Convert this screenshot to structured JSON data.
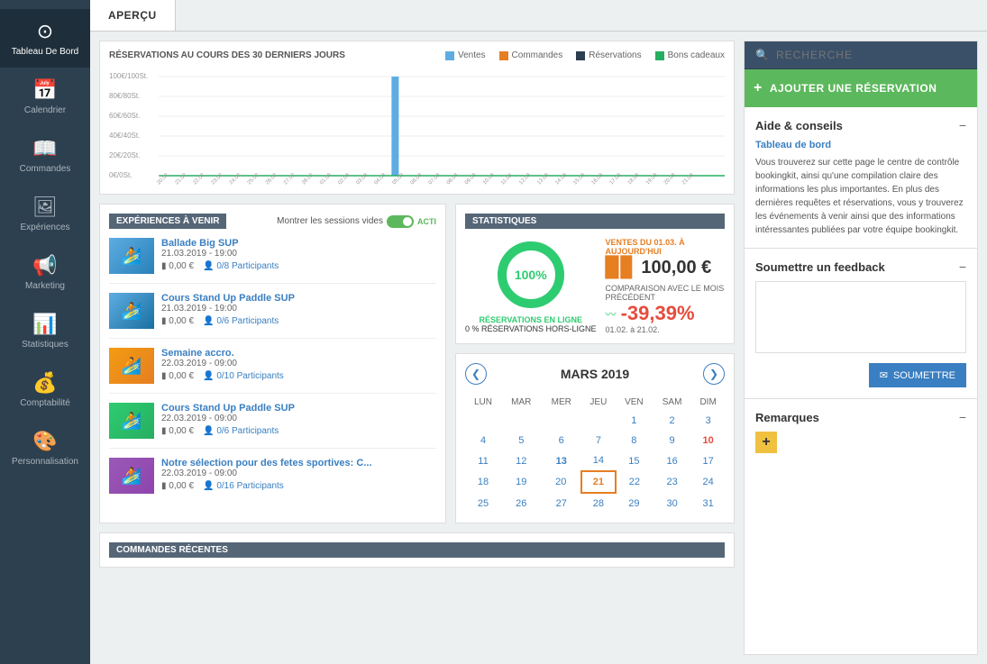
{
  "sidebar": {
    "items": [
      {
        "id": "tableau",
        "label": "Tableau De Bord",
        "icon": "⊙",
        "active": true
      },
      {
        "id": "calendrier",
        "label": "Calendrier",
        "icon": "📅"
      },
      {
        "id": "commandes",
        "label": "Commandes",
        "icon": "📖"
      },
      {
        "id": "experiences",
        "label": "Expériences",
        "icon": "🖼"
      },
      {
        "id": "marketing",
        "label": "Marketing",
        "icon": "📢"
      },
      {
        "id": "statistiques",
        "label": "Statistiques",
        "icon": "📊"
      },
      {
        "id": "comptabilite",
        "label": "Comptabilité",
        "icon": "💰"
      },
      {
        "id": "personnalisation",
        "label": "Personnalisation",
        "icon": "🎨"
      }
    ]
  },
  "tab": {
    "label": "APERÇU"
  },
  "search": {
    "placeholder": "RECHERCHE"
  },
  "add_button": {
    "label": "AJOUTER UNE RÉSERVATION",
    "plus": "+"
  },
  "chart": {
    "title": "RÉSERVATIONS AU COURS DES 30 DERNIERS JOURS",
    "legend": [
      {
        "label": "Ventes",
        "color": "#5dade2"
      },
      {
        "label": "Commandes",
        "color": "#e67e22"
      },
      {
        "label": "Réservations",
        "color": "#2c3e50"
      },
      {
        "label": "Bons cadeaux",
        "color": "#27ae60"
      }
    ],
    "y_labels": [
      "100€ / 100 St.",
      "80€ / 80 St.",
      "60€ / 60 St.",
      "40€ / 40 St.",
      "20€ / 20 St.",
      "0€ / 0 St."
    ],
    "x_dates": [
      "20.02",
      "21.02",
      "22.02",
      "23.02",
      "24.02",
      "25.02",
      "26.02",
      "27.02",
      "28.02",
      "01.03",
      "02.03",
      "03.03",
      "04.03",
      "05.03",
      "06.03",
      "07.03",
      "08.03",
      "09.03",
      "10.03",
      "11.03",
      "12.03",
      "13.03",
      "14.03",
      "15.03",
      "16.03",
      "17.03",
      "18.03",
      "19.03",
      "20.03",
      "21.03"
    ],
    "spike_index": 14,
    "spike_height": 100
  },
  "experiences": {
    "section_title": "EXPÉRIENCES À VENIR",
    "toggle_label": "Montrer les sessions vides",
    "toggle_state": "ACTI",
    "items": [
      {
        "title": "Ballade Big SUP",
        "date": "21.03.2019 - 19:00",
        "price": "0,00 €",
        "participants": "0/8 Participants",
        "img_class": "exp-img-1"
      },
      {
        "title": "Cours Stand Up Paddle SUP",
        "date": "21.03.2019 - 19:00",
        "price": "0,00 €",
        "participants": "0/6 Participants",
        "img_class": "exp-img-2"
      },
      {
        "title": "Semaine accro.",
        "date": "22.03.2019 - 09:00",
        "price": "0,00 €",
        "participants": "0/10 Participants",
        "img_class": "exp-img-3"
      },
      {
        "title": "Cours Stand Up Paddle SUP",
        "date": "22.03.2019 - 09:00",
        "price": "0,00 €",
        "participants": "0/6 Participants",
        "img_class": "exp-img-4"
      },
      {
        "title": "Notre sélection pour des fetes sportives: C...",
        "date": "22.03.2019 - 09:00",
        "price": "0,00 €",
        "participants": "0/16 Participants",
        "img_class": "exp-img-5"
      }
    ]
  },
  "statistics": {
    "section_title": "STATISTIQUES",
    "donut_percent": "100%",
    "sales_label": "VENTES DU 01.03. À AUJOURD'HUI",
    "sales_amount": "100,00 €",
    "comparison_label": "COMPARAISON AVEC LE MOIS PRÉCÉDENT",
    "comparison_range": "01.02. à 21.02.",
    "percent_change": "-39,39%",
    "reservations_label": "RÉSERVATIONS EN LIGNE",
    "reservations_sub": "0 % RÉSERVATIONS HORS-LIGNE"
  },
  "calendar": {
    "month_label": "MARS 2019",
    "days": [
      "LUN",
      "MAR",
      "MER",
      "JEU",
      "VEN",
      "SAM",
      "DIM"
    ],
    "weeks": [
      [
        "",
        "",
        "",
        "",
        "1",
        "2",
        "3"
      ],
      [
        "4",
        "5",
        "6",
        "7",
        "8",
        "9",
        "10"
      ],
      [
        "11",
        "12",
        "13",
        "14",
        "15",
        "16",
        "17"
      ],
      [
        "18",
        "19",
        "20",
        "21",
        "22",
        "23",
        "24"
      ],
      [
        "25",
        "26",
        "27",
        "28",
        "29",
        "30",
        "31"
      ]
    ],
    "today": "21",
    "colored_dates": [
      "10",
      "13",
      "21"
    ],
    "prev_icon": "❮",
    "next_icon": "❯"
  },
  "commands_recent": {
    "section_title": "COMMANDES RÉCENTES"
  },
  "help": {
    "title": "Aide & conseils",
    "minimize": "−",
    "subtitle": "Tableau de bord",
    "text": "Vous trouverez sur cette page le centre de contrôle bookingkit, ainsi qu'une compilation claire des informations les plus importantes. En plus des dernières requêtes et réservations, vous y trouverez les événements à venir ainsi que des informations intéressantes publiées par votre équipe bookingkit."
  },
  "feedback": {
    "title": "Soumettre un feedback",
    "minimize": "−",
    "submit_label": "SOUMETTRE",
    "email_icon": "✉"
  },
  "remarks": {
    "title": "Remarques",
    "minimize": "−",
    "add_icon": "+"
  }
}
